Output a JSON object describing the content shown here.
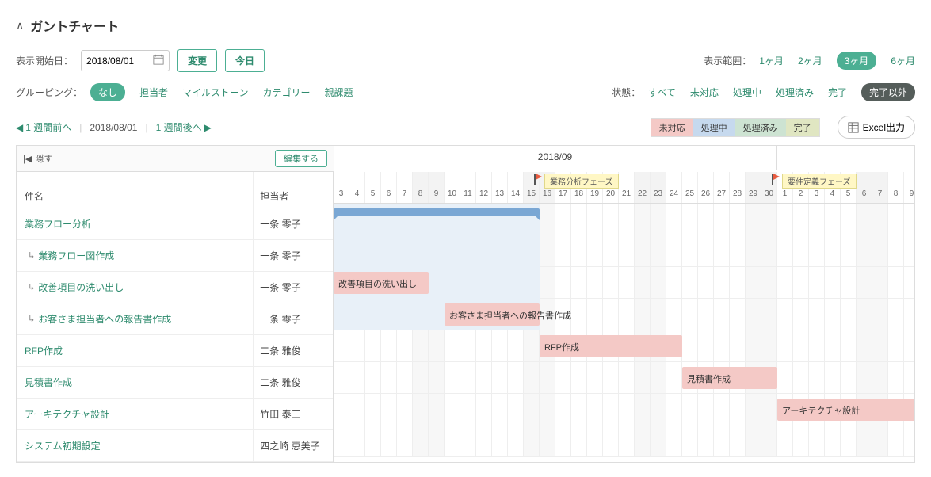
{
  "title": "ガントチャート",
  "startDate": {
    "label": "表示開始日：",
    "value": "2018/08/01",
    "changeBtn": "変更",
    "todayBtn": "今日"
  },
  "viewRange": {
    "label": "表示範囲：",
    "options": [
      "1ヶ月",
      "2ヶ月",
      "3ヶ月",
      "6ヶ月"
    ],
    "active": "3ヶ月"
  },
  "grouping": {
    "label": "グルーピング：",
    "options": [
      "なし",
      "担当者",
      "マイルストーン",
      "カテゴリー",
      "親課題"
    ],
    "active": "なし"
  },
  "status": {
    "label": "状態：",
    "options": [
      "すべて",
      "未対応",
      "処理中",
      "処理済み",
      "完了",
      "完了以外"
    ],
    "active": "完了以外"
  },
  "nav": {
    "prev": "1 週間前へ",
    "date": "2018/08/01",
    "next": "1 週間後へ"
  },
  "legend": {
    "notstarted": "未対応",
    "processing": "処理中",
    "done": "処理済み",
    "complete": "完了"
  },
  "excelBtn": "Excel出力",
  "hideBtn": "隠す",
  "editBtn": "編集する",
  "columns": {
    "subject": "件名",
    "assignee": "担当者"
  },
  "monthHeader": "2018/09",
  "milestones": [
    {
      "label": "業務分析フェーズ",
      "col": 13
    },
    {
      "label": "要件定義フェーズ",
      "col": 28
    }
  ],
  "days": [
    {
      "d": "3",
      "w": false
    },
    {
      "d": "4",
      "w": false
    },
    {
      "d": "5",
      "w": false
    },
    {
      "d": "6",
      "w": false
    },
    {
      "d": "7",
      "w": false
    },
    {
      "d": "8",
      "w": true
    },
    {
      "d": "9",
      "w": true
    },
    {
      "d": "10",
      "w": false
    },
    {
      "d": "11",
      "w": false
    },
    {
      "d": "12",
      "w": false
    },
    {
      "d": "13",
      "w": false
    },
    {
      "d": "14",
      "w": false
    },
    {
      "d": "15",
      "w": true
    },
    {
      "d": "16",
      "w": true
    },
    {
      "d": "17",
      "w": false
    },
    {
      "d": "18",
      "w": false
    },
    {
      "d": "19",
      "w": false
    },
    {
      "d": "20",
      "w": false
    },
    {
      "d": "21",
      "w": false
    },
    {
      "d": "22",
      "w": true
    },
    {
      "d": "23",
      "w": true
    },
    {
      "d": "24",
      "w": false
    },
    {
      "d": "25",
      "w": false
    },
    {
      "d": "26",
      "w": false
    },
    {
      "d": "27",
      "w": false
    },
    {
      "d": "28",
      "w": false
    },
    {
      "d": "29",
      "w": true
    },
    {
      "d": "30",
      "w": true
    },
    {
      "d": "1",
      "w": false
    },
    {
      "d": "2",
      "w": false
    },
    {
      "d": "3",
      "w": false
    },
    {
      "d": "4",
      "w": false
    },
    {
      "d": "5",
      "w": false
    },
    {
      "d": "6",
      "w": true
    },
    {
      "d": "7",
      "w": true
    },
    {
      "d": "8",
      "w": false
    },
    {
      "d": "9",
      "w": false
    }
  ],
  "tasks": [
    {
      "subject": "業務フロー分析",
      "assignee": "一条 零子",
      "indent": false,
      "bar": {
        "type": "parent",
        "start": 0,
        "end": 13
      },
      "bg": {
        "start": 0,
        "end": 13
      }
    },
    {
      "subject": "業務フロー図作成",
      "assignee": "一条 零子",
      "indent": true,
      "bar": null,
      "bg": {
        "start": 0,
        "end": 13
      }
    },
    {
      "subject": "改善項目の洗い出し",
      "assignee": "一条 零子",
      "indent": true,
      "bar": {
        "type": "notstarted",
        "label": "改善項目の洗い出し",
        "start": 0,
        "end": 6
      },
      "bg": {
        "start": 0,
        "end": 13
      }
    },
    {
      "subject": "お客さま担当者への報告書作成",
      "assignee": "一条 零子",
      "indent": true,
      "bar": {
        "type": "notstarted",
        "label": "お客さま担当者への報告書作成",
        "start": 7,
        "end": 13
      },
      "bg": {
        "start": 0,
        "end": 13
      }
    },
    {
      "subject": "RFP作成",
      "assignee": "二条 雅俊",
      "indent": false,
      "bar": {
        "type": "notstarted",
        "label": "RFP作成",
        "start": 13,
        "end": 22
      }
    },
    {
      "subject": "見積書作成",
      "assignee": "二条 雅俊",
      "indent": false,
      "bar": {
        "type": "notstarted",
        "label": "見積書作成",
        "start": 22,
        "end": 28
      }
    },
    {
      "subject": "アーキテクチャ設計",
      "assignee": "竹田 泰三",
      "indent": false,
      "bar": {
        "type": "notstarted",
        "label": "アーキテクチャ設計",
        "start": 28,
        "end": 37
      }
    },
    {
      "subject": "システム初期設定",
      "assignee": "四之崎 恵美子",
      "indent": false,
      "bar": null
    }
  ]
}
